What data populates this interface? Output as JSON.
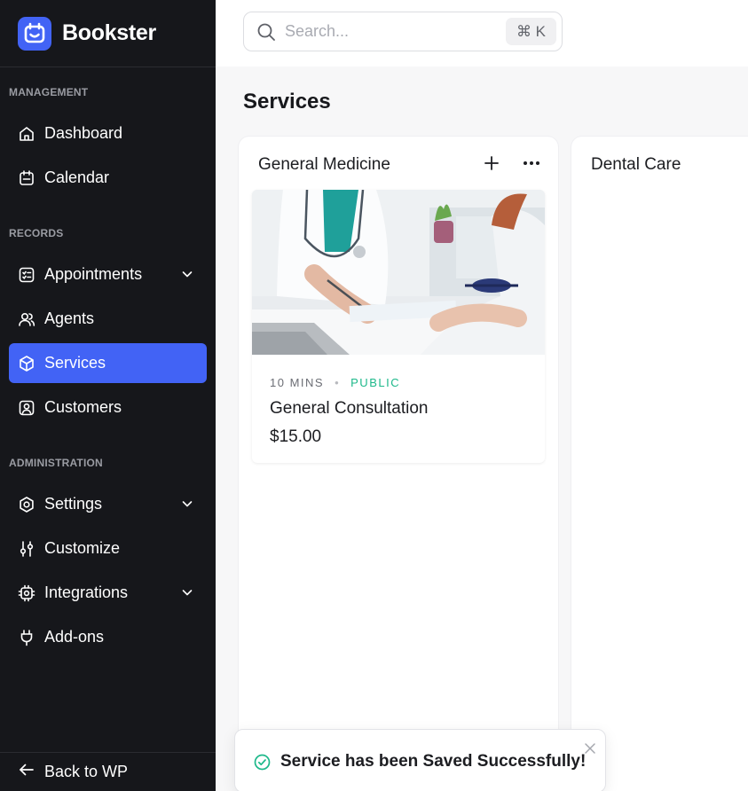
{
  "brand": {
    "name": "Bookster",
    "accent": "#4263f5"
  },
  "search": {
    "placeholder": "Search...",
    "shortcut": "⌘ K"
  },
  "sidebar": {
    "sections": [
      {
        "label": "MANAGEMENT"
      },
      {
        "label": "RECORDS"
      },
      {
        "label": "ADMINISTRATION"
      }
    ],
    "items": [
      {
        "label": "Dashboard",
        "icon": "home-icon"
      },
      {
        "label": "Calendar",
        "icon": "calendar-icon"
      },
      {
        "label": "Appointments",
        "icon": "checklist-icon",
        "expandable": true
      },
      {
        "label": "Agents",
        "icon": "users-icon"
      },
      {
        "label": "Services",
        "icon": "box-icon",
        "active": true
      },
      {
        "label": "Customers",
        "icon": "user-card-icon"
      },
      {
        "label": "Settings",
        "icon": "gear-icon",
        "expandable": true
      },
      {
        "label": "Customize",
        "icon": "sliders-icon"
      },
      {
        "label": "Integrations",
        "icon": "chip-icon",
        "expandable": true
      },
      {
        "label": "Add-ons",
        "icon": "plug-icon"
      }
    ],
    "back_label": "Back to WP"
  },
  "main": {
    "title": "Services",
    "columns": [
      {
        "title": "General Medicine",
        "services": [
          {
            "duration": "10 MINS",
            "visibility": "PUBLIC",
            "name": "General Consultation",
            "price": "$15.00",
            "image": "doctor-consultation-photo"
          }
        ]
      },
      {
        "title": "Dental Care",
        "services": []
      }
    ]
  },
  "toast": {
    "message": "Service has been Saved Successfully!",
    "status_color": "#1db88a"
  }
}
